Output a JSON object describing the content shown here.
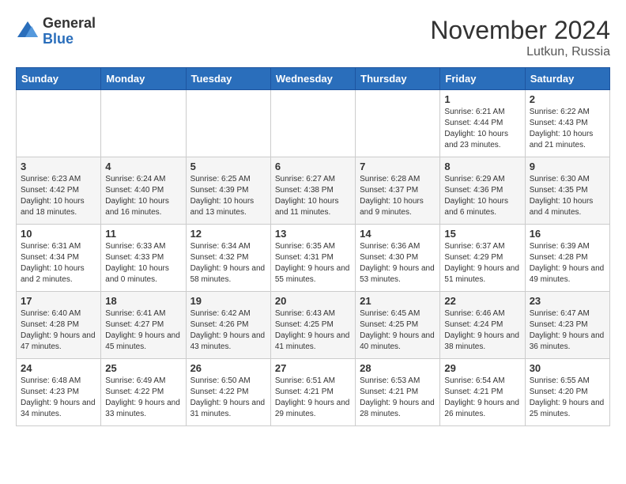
{
  "header": {
    "logo_general": "General",
    "logo_blue": "Blue",
    "month": "November 2024",
    "location": "Lutkun, Russia"
  },
  "days_of_week": [
    "Sunday",
    "Monday",
    "Tuesday",
    "Wednesday",
    "Thursday",
    "Friday",
    "Saturday"
  ],
  "weeks": [
    [
      {
        "day": "",
        "info": ""
      },
      {
        "day": "",
        "info": ""
      },
      {
        "day": "",
        "info": ""
      },
      {
        "day": "",
        "info": ""
      },
      {
        "day": "",
        "info": ""
      },
      {
        "day": "1",
        "info": "Sunrise: 6:21 AM\nSunset: 4:44 PM\nDaylight: 10 hours and 23 minutes."
      },
      {
        "day": "2",
        "info": "Sunrise: 6:22 AM\nSunset: 4:43 PM\nDaylight: 10 hours and 21 minutes."
      }
    ],
    [
      {
        "day": "3",
        "info": "Sunrise: 6:23 AM\nSunset: 4:42 PM\nDaylight: 10 hours and 18 minutes."
      },
      {
        "day": "4",
        "info": "Sunrise: 6:24 AM\nSunset: 4:40 PM\nDaylight: 10 hours and 16 minutes."
      },
      {
        "day": "5",
        "info": "Sunrise: 6:25 AM\nSunset: 4:39 PM\nDaylight: 10 hours and 13 minutes."
      },
      {
        "day": "6",
        "info": "Sunrise: 6:27 AM\nSunset: 4:38 PM\nDaylight: 10 hours and 11 minutes."
      },
      {
        "day": "7",
        "info": "Sunrise: 6:28 AM\nSunset: 4:37 PM\nDaylight: 10 hours and 9 minutes."
      },
      {
        "day": "8",
        "info": "Sunrise: 6:29 AM\nSunset: 4:36 PM\nDaylight: 10 hours and 6 minutes."
      },
      {
        "day": "9",
        "info": "Sunrise: 6:30 AM\nSunset: 4:35 PM\nDaylight: 10 hours and 4 minutes."
      }
    ],
    [
      {
        "day": "10",
        "info": "Sunrise: 6:31 AM\nSunset: 4:34 PM\nDaylight: 10 hours and 2 minutes."
      },
      {
        "day": "11",
        "info": "Sunrise: 6:33 AM\nSunset: 4:33 PM\nDaylight: 10 hours and 0 minutes."
      },
      {
        "day": "12",
        "info": "Sunrise: 6:34 AM\nSunset: 4:32 PM\nDaylight: 9 hours and 58 minutes."
      },
      {
        "day": "13",
        "info": "Sunrise: 6:35 AM\nSunset: 4:31 PM\nDaylight: 9 hours and 55 minutes."
      },
      {
        "day": "14",
        "info": "Sunrise: 6:36 AM\nSunset: 4:30 PM\nDaylight: 9 hours and 53 minutes."
      },
      {
        "day": "15",
        "info": "Sunrise: 6:37 AM\nSunset: 4:29 PM\nDaylight: 9 hours and 51 minutes."
      },
      {
        "day": "16",
        "info": "Sunrise: 6:39 AM\nSunset: 4:28 PM\nDaylight: 9 hours and 49 minutes."
      }
    ],
    [
      {
        "day": "17",
        "info": "Sunrise: 6:40 AM\nSunset: 4:28 PM\nDaylight: 9 hours and 47 minutes."
      },
      {
        "day": "18",
        "info": "Sunrise: 6:41 AM\nSunset: 4:27 PM\nDaylight: 9 hours and 45 minutes."
      },
      {
        "day": "19",
        "info": "Sunrise: 6:42 AM\nSunset: 4:26 PM\nDaylight: 9 hours and 43 minutes."
      },
      {
        "day": "20",
        "info": "Sunrise: 6:43 AM\nSunset: 4:25 PM\nDaylight: 9 hours and 41 minutes."
      },
      {
        "day": "21",
        "info": "Sunrise: 6:45 AM\nSunset: 4:25 PM\nDaylight: 9 hours and 40 minutes."
      },
      {
        "day": "22",
        "info": "Sunrise: 6:46 AM\nSunset: 4:24 PM\nDaylight: 9 hours and 38 minutes."
      },
      {
        "day": "23",
        "info": "Sunrise: 6:47 AM\nSunset: 4:23 PM\nDaylight: 9 hours and 36 minutes."
      }
    ],
    [
      {
        "day": "24",
        "info": "Sunrise: 6:48 AM\nSunset: 4:23 PM\nDaylight: 9 hours and 34 minutes."
      },
      {
        "day": "25",
        "info": "Sunrise: 6:49 AM\nSunset: 4:22 PM\nDaylight: 9 hours and 33 minutes."
      },
      {
        "day": "26",
        "info": "Sunrise: 6:50 AM\nSunset: 4:22 PM\nDaylight: 9 hours and 31 minutes."
      },
      {
        "day": "27",
        "info": "Sunrise: 6:51 AM\nSunset: 4:21 PM\nDaylight: 9 hours and 29 minutes."
      },
      {
        "day": "28",
        "info": "Sunrise: 6:53 AM\nSunset: 4:21 PM\nDaylight: 9 hours and 28 minutes."
      },
      {
        "day": "29",
        "info": "Sunrise: 6:54 AM\nSunset: 4:21 PM\nDaylight: 9 hours and 26 minutes."
      },
      {
        "day": "30",
        "info": "Sunrise: 6:55 AM\nSunset: 4:20 PM\nDaylight: 9 hours and 25 minutes."
      }
    ]
  ]
}
